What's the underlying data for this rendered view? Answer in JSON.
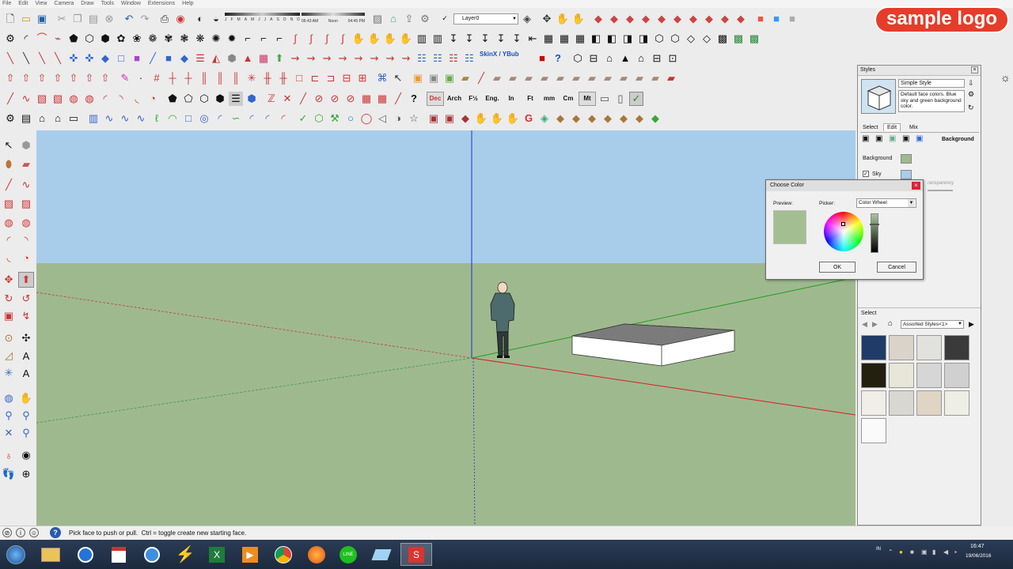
{
  "menu": [
    "File",
    "Edit",
    "View",
    "Camera",
    "Draw",
    "Tools",
    "Window",
    "Extensions",
    "Help"
  ],
  "shadow": {
    "time_start": "06:43 AM",
    "time_mid": "Noon",
    "time_end": "04:45 PM",
    "months": [
      "J",
      "F",
      "M",
      "A",
      "M",
      "J",
      "J",
      "A",
      "S",
      "O",
      "N",
      "D"
    ]
  },
  "layer": {
    "value": "Layer0"
  },
  "skin_label": "SkinX / YBub",
  "units_buttons": [
    "Dec",
    "Arch",
    "F½",
    "Eng.",
    "In",
    "Ft",
    "mm",
    "Cm",
    "Mt"
  ],
  "logo_text": "sample logo",
  "status": {
    "text": "Pick face to push or pull.  Ctrl = toggle create new starting face."
  },
  "styles": {
    "title": "Styles",
    "style_name": "Simple Style",
    "style_desc": "Default face colors. Blue sky and green background color.",
    "tabs": [
      "Select",
      "Edit",
      "Mix"
    ],
    "section": "Background",
    "rows": [
      {
        "label": "Background"
      },
      {
        "label": "Sky"
      }
    ],
    "transparency_fragment": "ransparency",
    "select_label": "Select",
    "collection": "Assorted Styles<1>"
  },
  "color_dialog": {
    "title": "Choose Color",
    "preview_label": "Preview:",
    "picker_label": "Picker:",
    "picker_value": "Color Wheel",
    "ok": "OK",
    "cancel": "Cancel"
  },
  "tray": {
    "lang": "IN",
    "time": "16:47",
    "date": "19/06/2016"
  },
  "colors": {
    "sky": "#a8cdea",
    "ground": "#9fb98f",
    "background": "#a3bf92"
  }
}
